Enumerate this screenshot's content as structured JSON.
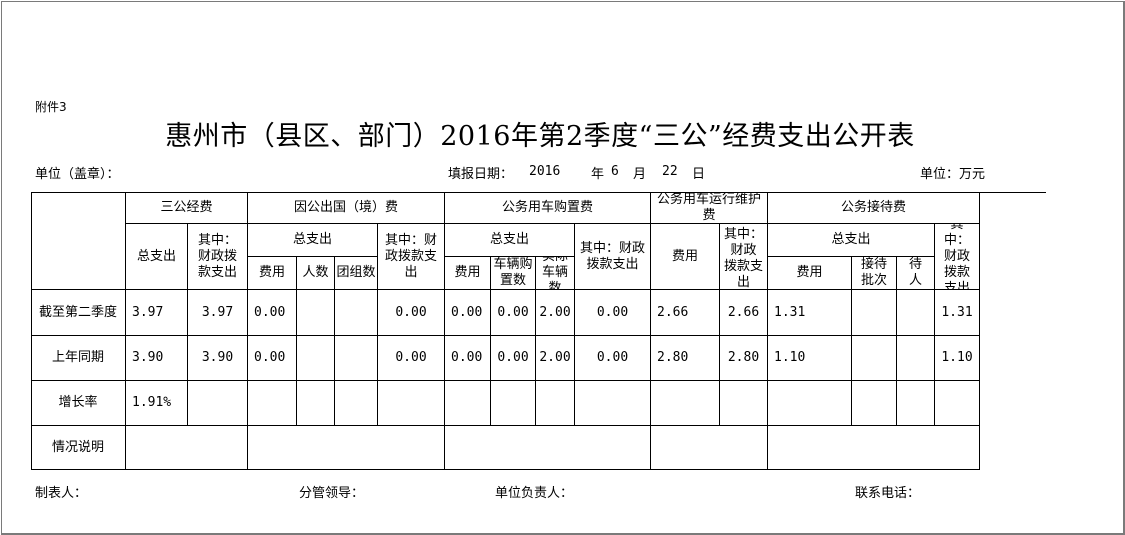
{
  "doc": {
    "attachment": "附件3",
    "title": "惠州市（县区、部门）2016年第2季度“三公”经费支出公开表",
    "unit_seal": "单位（盖章）：",
    "fill_date_label": "填报日期：",
    "fill_year": "2016",
    "year_char": "年",
    "fill_month": "6",
    "month_char": "月",
    "fill_day": "22",
    "day_char": "日",
    "unit_label": "单位：万元"
  },
  "headers": {
    "sangong": "三公经费",
    "abroad": "因公出国（境）费",
    "car_purchase": "公务用车购置费",
    "car_run": "公务用车运行维护费",
    "reception": "公务接待费",
    "total_exp": "总支出",
    "of_which_fiscal": "其中：财政拨款支出",
    "total": "总支出",
    "fee": "费用",
    "people": "人数",
    "groups": "团组数",
    "fiscal_exp": "其中：财政拨款支出",
    "cars_bought": "车辆购置数",
    "actual_cars": "实际车辆数",
    "fiscal_short": "其中：财政",
    "fiscal_tail": "拨款支出",
    "batches": "接待批次",
    "persons": "接待人数"
  },
  "rows": [
    {
      "label": "截至第二季度",
      "sg_total": "3.97",
      "sg_fiscal": "3.97",
      "ab_fee": "0.00",
      "ab_people": "",
      "ab_groups": "",
      "ab_fiscal": "0.00",
      "cp_fee": "0.00",
      "cp_num": "0.00",
      "cp_actual": "2.00",
      "cp_fiscal": "0.00",
      "cr_fee": "2.66",
      "cr_fiscal": "2.66",
      "rc_fee": "1.31",
      "rc_batch": "",
      "rc_persons": "",
      "rc_fiscal": "1.31"
    },
    {
      "label": "上年同期",
      "sg_total": "3.90",
      "sg_fiscal": "3.90",
      "ab_fee": "0.00",
      "ab_people": "",
      "ab_groups": "",
      "ab_fiscal": "0.00",
      "cp_fee": "0.00",
      "cp_num": "0.00",
      "cp_actual": "2.00",
      "cp_fiscal": "0.00",
      "cr_fee": "2.80",
      "cr_fiscal": "2.80",
      "rc_fee": "1.10",
      "rc_batch": "",
      "rc_persons": "",
      "rc_fiscal": "1.10"
    },
    {
      "label": "增长率",
      "sg_total": "1.91%",
      "sg_fiscal": "",
      "ab_fee": "",
      "ab_people": "",
      "ab_groups": "",
      "ab_fiscal": "",
      "cp_fee": "",
      "cp_num": "",
      "cp_actual": "",
      "cp_fiscal": "",
      "cr_fee": "",
      "cr_fiscal": "",
      "rc_fee": "",
      "rc_batch": "",
      "rc_persons": "",
      "rc_fiscal": ""
    }
  ],
  "remarks_label": "情况说明",
  "footer": {
    "preparer": "制表人：",
    "supervisor": "分管领导：",
    "unit_head": "单位负责人：",
    "phone": "联系电话："
  }
}
